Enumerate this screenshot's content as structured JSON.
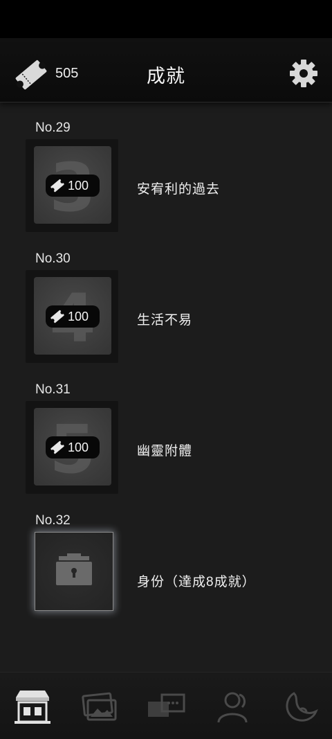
{
  "header": {
    "ticket_count": "505",
    "title": "成就"
  },
  "achievements": [
    {
      "no": "No.29",
      "name": "安宥利的過去",
      "reward": "100",
      "numeral": "3",
      "locked": false
    },
    {
      "no": "No.30",
      "name": "生活不易",
      "reward": "100",
      "numeral": "4",
      "locked": false
    },
    {
      "no": "No.31",
      "name": "幽靈附體",
      "reward": "100",
      "numeral": "5",
      "locked": false
    },
    {
      "no": "No.32",
      "name": "身份（達成8成就）",
      "locked": true
    }
  ],
  "tabs": [
    {
      "icon": "shop-icon",
      "active": true
    },
    {
      "icon": "gallery-icon",
      "active": false
    },
    {
      "icon": "chat-cards-icon",
      "active": false
    },
    {
      "icon": "characters-icon",
      "active": false
    },
    {
      "icon": "moon-icon",
      "active": false
    }
  ],
  "colors": {
    "background": "#1c1c1c",
    "header": "#0b0b0b",
    "pill": "#080808",
    "glow": "#d2dceb"
  }
}
